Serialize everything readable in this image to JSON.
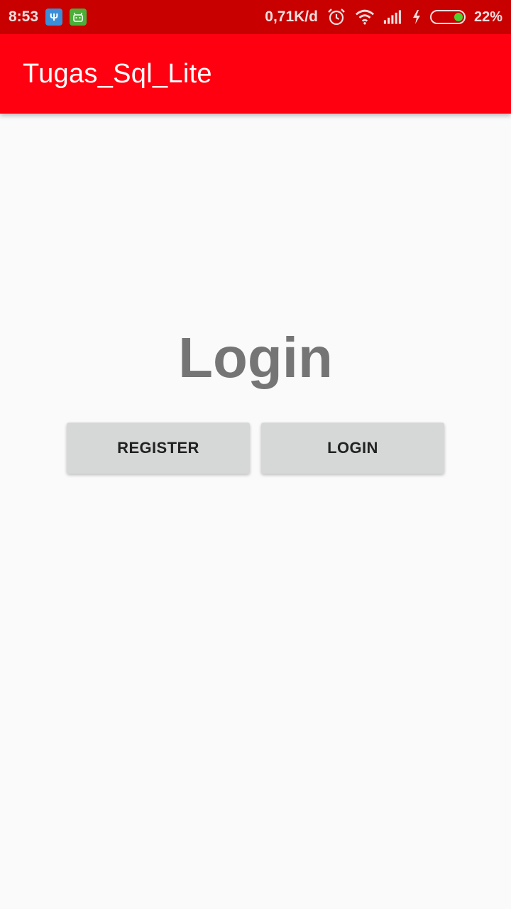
{
  "status_bar": {
    "time": "8:53",
    "notification_icons": [
      "usb-icon",
      "android-debug-icon"
    ],
    "network_speed": "0,71K/d",
    "status_icons": [
      "alarm-icon",
      "wifi-icon",
      "signal-icon",
      "charging-icon",
      "battery-icon"
    ],
    "battery_percent": "22%",
    "battery_level": 0.22,
    "background_color": "#c80000"
  },
  "app_bar": {
    "title": "Tugas_Sql_Lite",
    "background_color": "#ff0010"
  },
  "main": {
    "heading": "Login",
    "buttons": {
      "register_label": "REGISTER",
      "login_label": "LOGIN"
    }
  }
}
